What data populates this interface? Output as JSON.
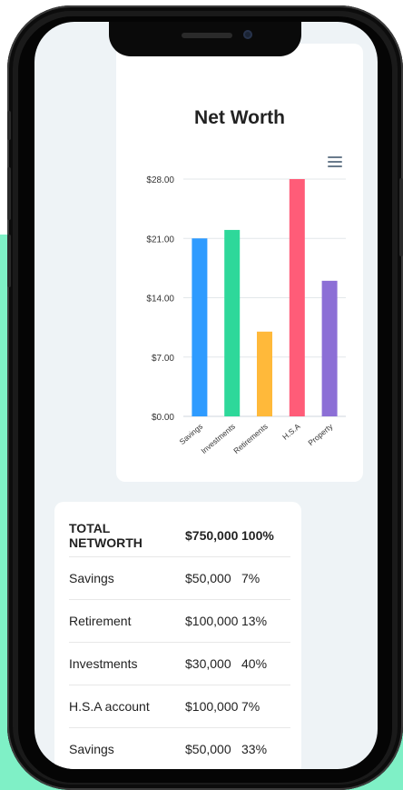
{
  "chart": {
    "title": "Net Worth",
    "menu_icon": "hamburger-menu-icon"
  },
  "chart_data": {
    "type": "bar",
    "title": "Net Worth",
    "categories": [
      "Savings",
      "Investments",
      "Retirements",
      "H.S.A",
      "Property"
    ],
    "values": [
      21,
      22,
      10,
      28,
      16
    ],
    "colors": [
      "#2e9bff",
      "#2ed89a",
      "#ffb93a",
      "#ff5c78",
      "#8c6fd6"
    ],
    "y_ticks": [
      "$0.00",
      "$7.00",
      "$14.00",
      "$21.00",
      "$28.00"
    ],
    "ylim": [
      0,
      28
    ],
    "grid": true,
    "xlabel": "",
    "ylabel": ""
  },
  "table": {
    "header": {
      "name": "TOTAL NETWORTH",
      "amount": "$750,000",
      "percent": "100%"
    },
    "rows": [
      {
        "name": "Savings",
        "amount": "$50,000",
        "percent": "7%"
      },
      {
        "name": "Retirement",
        "amount": "$100,000",
        "percent": "13%"
      },
      {
        "name": "Investments",
        "amount": "$30,000",
        "percent": "40%"
      },
      {
        "name": "H.S.A account",
        "amount": "$100,000",
        "percent": "7%"
      },
      {
        "name": "Savings",
        "amount": "$50,000",
        "percent": "33%"
      }
    ]
  }
}
